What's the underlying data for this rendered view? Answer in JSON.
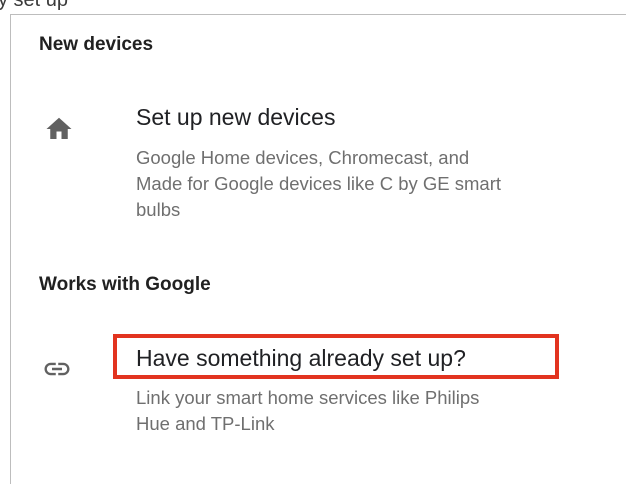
{
  "top_fragment": "y set up",
  "sections": [
    {
      "header": "New devices",
      "item": {
        "icon": "home-icon",
        "title": "Set up new devices",
        "description_lines": [
          "Google Home devices, Chromecast, and",
          "Made for Google devices like C by GE smart",
          "bulbs"
        ]
      }
    },
    {
      "header": "Works with Google",
      "item": {
        "icon": "link-icon",
        "title": "Have something already set up?",
        "description_lines": [
          "Link your smart home services like Philips",
          "Hue and TP-Link"
        ]
      }
    }
  ],
  "colors": {
    "highlight": "#e2331f",
    "icon": "#616161",
    "secondary_text": "#6f6f6f"
  }
}
